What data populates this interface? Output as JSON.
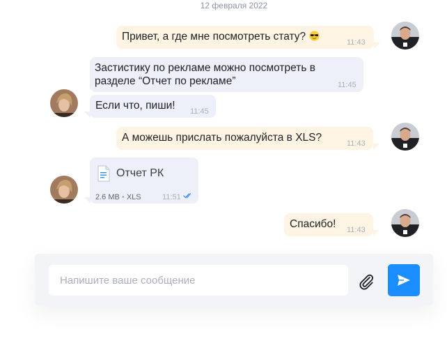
{
  "chat": {
    "date": "12 февраля 2022",
    "messages": [
      {
        "direction": "outgoing",
        "text": "Привет, а где мне посмотреть стату?",
        "emoji": "sunglasses-emoji",
        "time": "11:43"
      },
      {
        "direction": "incoming",
        "text": "Застистику по рекламе можно посмотреть в разделе “Отчет по рекламе”",
        "time": "11:45"
      },
      {
        "direction": "incoming",
        "text": "Если что, пиши!",
        "time": "11:45"
      },
      {
        "direction": "outgoing",
        "text": "А можешь прислать пожалуйста в XLS?",
        "time": "11:43"
      },
      {
        "direction": "incoming",
        "type": "file",
        "file_name": "Отчет РК",
        "size": "2.6 MB",
        "separator": "•",
        "format": "XLS",
        "time": "11:51",
        "status": "read"
      },
      {
        "direction": "outgoing",
        "text": "Спасибо!",
        "time": "11:43"
      }
    ]
  },
  "composer": {
    "placeholder": "Напишите ваше сообщение",
    "attach_icon": "paperclip-icon",
    "send_icon": "send-icon"
  },
  "colors": {
    "outgoing_bubble": "#fdf4e3",
    "incoming_bubble": "#edf0f8",
    "send_button": "#1a8dff",
    "read_checks": "#2f8cff"
  }
}
